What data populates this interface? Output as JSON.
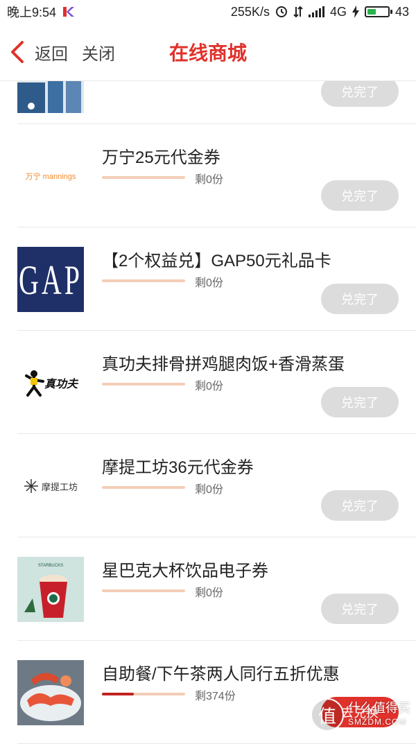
{
  "status_bar": {
    "time": "晚上9:54",
    "speed": "255K/s",
    "network": "4G",
    "battery": "43",
    "battery_level": 0.43
  },
  "nav": {
    "back_label": "返回",
    "close_label": "关闭",
    "title": "在线商城"
  },
  "top_item": {
    "button": "兑完了"
  },
  "items": [
    {
      "name": "万宁25元代金券",
      "remain": "剩0份",
      "progress": 0,
      "button": "兑完了",
      "logo": "mannings-logo",
      "logo_text": "万宁 mannings"
    },
    {
      "name": "【2个权益兑】GAP50元礼品卡",
      "remain": "剩0份",
      "progress": 0,
      "button": "兑完了",
      "logo": "gap-logo",
      "logo_text": "GAP"
    },
    {
      "name": "真功夫排骨拼鸡腿肉饭+香滑蒸蛋",
      "remain": "剩0份",
      "progress": 0,
      "button": "兑完了",
      "logo": "zhengongfu-logo",
      "logo_text": "真功夫"
    },
    {
      "name": "摩提工坊36元代金券",
      "remain": "剩0份",
      "progress": 0,
      "button": "兑完了",
      "logo": "mochi-logo",
      "logo_text": "摩提工坊"
    },
    {
      "name": "星巴克大杯饮品电子券",
      "remain": "剩0份",
      "progress": 0,
      "button": "兑完了",
      "logo": "starbucks-image",
      "logo_text": "STARBUCKS"
    },
    {
      "name": "自助餐/下午茶两人同行五折优惠",
      "remain": "剩374份",
      "progress": 0.38,
      "button": "去兑换",
      "logo": "buffet-image",
      "logo_text": ""
    }
  ],
  "watermark": {
    "glyph": "值",
    "line1": "什么值得买",
    "line2": "SMZDM.COM"
  },
  "colors": {
    "accent": "#e0312b",
    "disabled": "#dcdcdc",
    "bar_track": "#f4cdb8",
    "bar_fill": "#c0231e",
    "gap_blue": "#1f2f67"
  }
}
